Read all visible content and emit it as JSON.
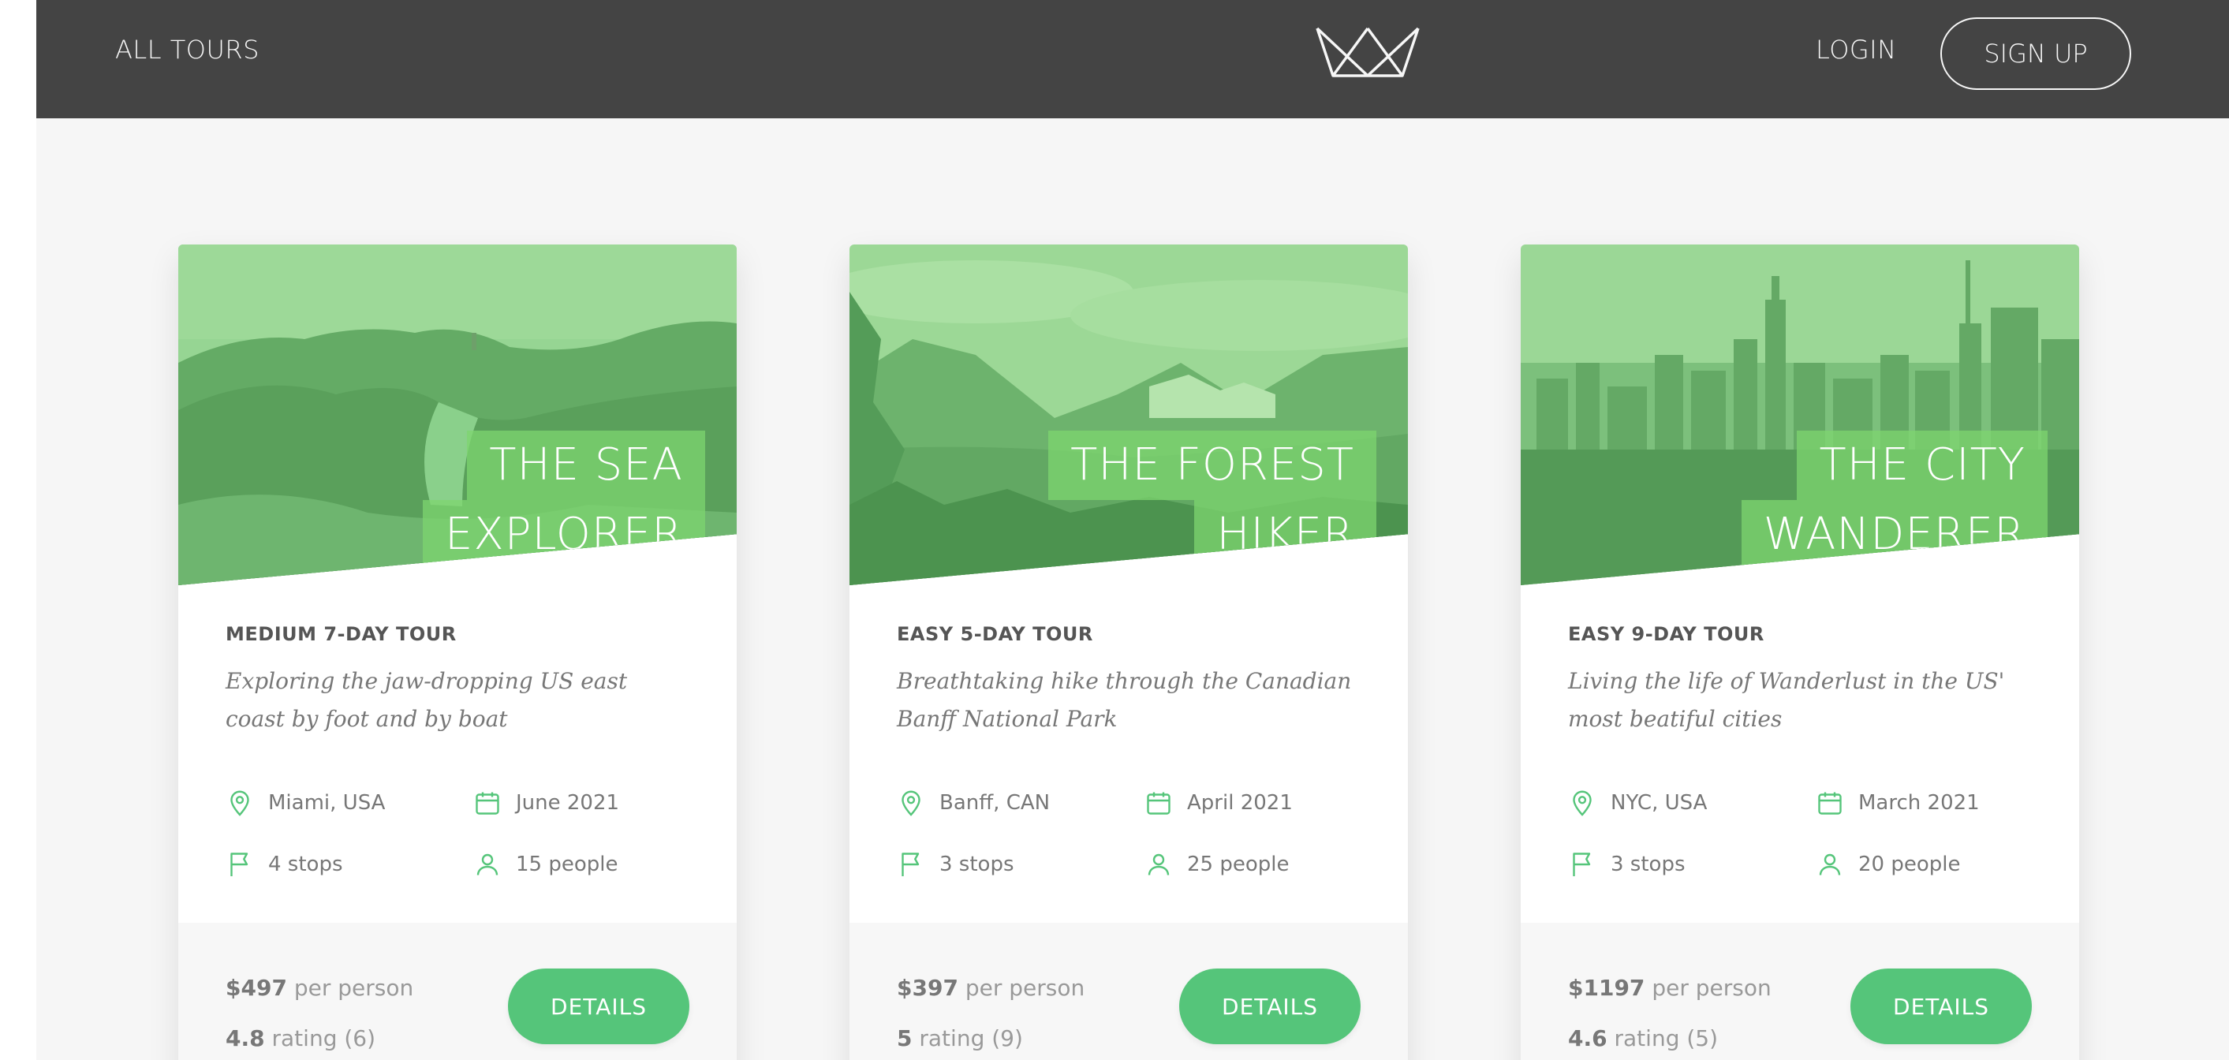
{
  "header": {
    "all_tours": "ALL TOURS",
    "login": "LOGIN",
    "signup": "SIGN UP",
    "logo_icon": "crown-logo-icon"
  },
  "colors": {
    "brand_green": "#55c57a",
    "header_bg": "#444444",
    "page_bg": "#f6f6f6"
  },
  "cards": [
    {
      "title_line1": "THE SEA",
      "title_line2": "EXPLORER",
      "subtitle": "MEDIUM 7-DAY TOUR",
      "description": "Exploring the jaw-dropping US east coast by foot and by boat",
      "location": "Miami, USA",
      "date": "June 2021",
      "stops": "4 stops",
      "people": "15 people",
      "price": "$497",
      "price_unit": "per person",
      "rating": "4.8",
      "rating_label": "rating",
      "rating_count": "(6)",
      "button": "DETAILS"
    },
    {
      "title_line1": "THE FOREST",
      "title_line2": "HIKER",
      "subtitle": "EASY 5-DAY TOUR",
      "description": "Breathtaking hike through the Canadian Banff National Park",
      "location": "Banff, CAN",
      "date": "April 2021",
      "stops": "3 stops",
      "people": "25 people",
      "price": "$397",
      "price_unit": "per person",
      "rating": "5",
      "rating_label": "rating",
      "rating_count": "(9)",
      "button": "DETAILS"
    },
    {
      "title_line1": "THE CITY",
      "title_line2": "WANDERER",
      "subtitle": "EASY 9-DAY TOUR",
      "description": "Living the life of Wanderlust in the US' most beatiful cities",
      "location": "NYC, USA",
      "date": "March 2021",
      "stops": "3 stops",
      "people": "20 people",
      "price": "$1197",
      "price_unit": "per person",
      "rating": "4.6",
      "rating_label": "rating",
      "rating_count": "(5)",
      "button": "DETAILS"
    }
  ]
}
